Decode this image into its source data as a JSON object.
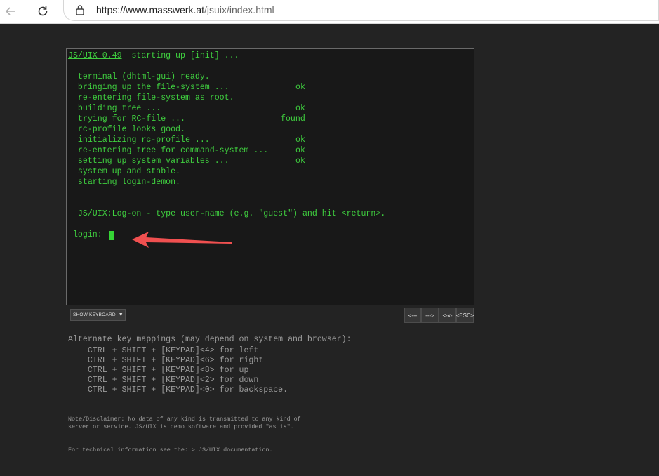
{
  "browser": {
    "back_icon": "arrow-left-icon",
    "reload_icon": "reload-icon",
    "lock_icon": "lock-icon",
    "url_host": "https://www.masswerk.at",
    "url_path": "/jsuix/index.html"
  },
  "terminal": {
    "brand": "JS/UIX 0.49",
    "header_rest": "  starting up [init] ...",
    "lines": [
      "  terminal (dhtml-gui) ready.",
      "  bringing up the file-system ...",
      "  re-entering file-system as root.",
      "  building tree ...",
      "  trying for RC-file ...",
      "  rc-profile looks good.",
      "  initializing rc-profile ...",
      "  re-entering tree for command-system ...",
      "  setting up system variables ...",
      "  system up and stable.",
      "  starting login-demon."
    ],
    "statuses": {
      "filesystem": "ok",
      "tree": "ok",
      "rcfile": "found",
      "rcprofile": "ok",
      "command_tree": "ok",
      "variables": "ok"
    },
    "logon_message": "  JS/UIX:Log-on - type user-name (e.g. \"guest\") and hit <return>.",
    "login_prompt": " login: "
  },
  "controls": {
    "show_keyboard": "SHOW KEYBOARD",
    "left": "<---",
    "right": "--->",
    "backspace": "<-x-",
    "esc": "<ESC>"
  },
  "help": {
    "intro": "Alternate key mappings (may depend on system and browser):",
    "mappings": [
      "    CTRL + SHIFT + [KEYPAD]<4> for left",
      "    CTRL + SHIFT + [KEYPAD]<6> for right",
      "    CTRL + SHIFT + [KEYPAD]<8> for up",
      "    CTRL + SHIFT + [KEYPAD]<2> for down",
      "    CTRL + SHIFT + [KEYPAD]<0> for backspace."
    ],
    "disclaimer_1": "Note/Disclaimer: No data of any kind is transmitted to any kind of",
    "disclaimer_2": "server or service. JS/UIX is demo software and provided \"as is\".",
    "tech_info": "For technical information see the: ",
    "doc_link": "> JS/UIX documentation",
    "doc_link_suffix": "."
  },
  "colors": {
    "terminal_text": "#3fcf3f",
    "annotation_arrow": "#f05050"
  }
}
